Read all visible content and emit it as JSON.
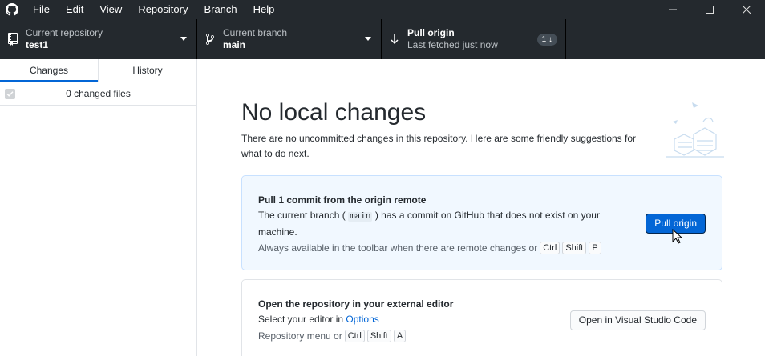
{
  "menu": [
    "File",
    "Edit",
    "View",
    "Repository",
    "Branch",
    "Help"
  ],
  "window_controls": {
    "minimize": "—",
    "maximize": "☐",
    "close": "✕"
  },
  "toolbar": {
    "repo": {
      "label": "Current repository",
      "value": "test1"
    },
    "branch": {
      "label": "Current branch",
      "value": "main"
    },
    "pull": {
      "label": "Pull origin",
      "sub": "Last fetched just now",
      "badge": "1 ↓"
    }
  },
  "sidebar": {
    "tabs": [
      "Changes",
      "History"
    ],
    "active_tab": "Changes",
    "changes_count": "0 changed files"
  },
  "main": {
    "heading": "No local changes",
    "intro": "There are no uncommitted changes in this repository. Here are some friendly suggestions for what to do next.",
    "pull_card": {
      "title": "Pull 1 commit from the origin remote",
      "desc_before": "The current branch (",
      "branch_code": "main",
      "desc_after": ") has a commit on GitHub that does not exist on your machine.",
      "hint": "Always available in the toolbar when there are remote changes or",
      "keys": [
        "Ctrl",
        "Shift",
        "P"
      ],
      "button": "Pull origin"
    },
    "editor_card": {
      "title": "Open the repository in your external editor",
      "desc_before": "Select your editor in",
      "link": "Options",
      "hint": "Repository menu or",
      "keys": [
        "Ctrl",
        "Shift",
        "A"
      ],
      "button": "Open in Visual Studio Code"
    }
  },
  "colors": {
    "toolbar_bg": "#24292e",
    "accent_blue": "#0366d6",
    "card_blue_bg": "#f1f8ff"
  }
}
